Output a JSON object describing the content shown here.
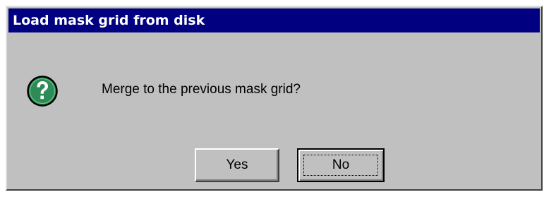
{
  "dialog": {
    "title": "Load mask grid from disk",
    "icon": "question-icon",
    "message": "Merge to the previous mask grid?",
    "buttons": {
      "yes_label": "Yes",
      "no_label": "No"
    }
  },
  "colors": {
    "titlebar": "#000080",
    "face": "#c0c0c0",
    "icon_fill": "#2e8b57"
  }
}
